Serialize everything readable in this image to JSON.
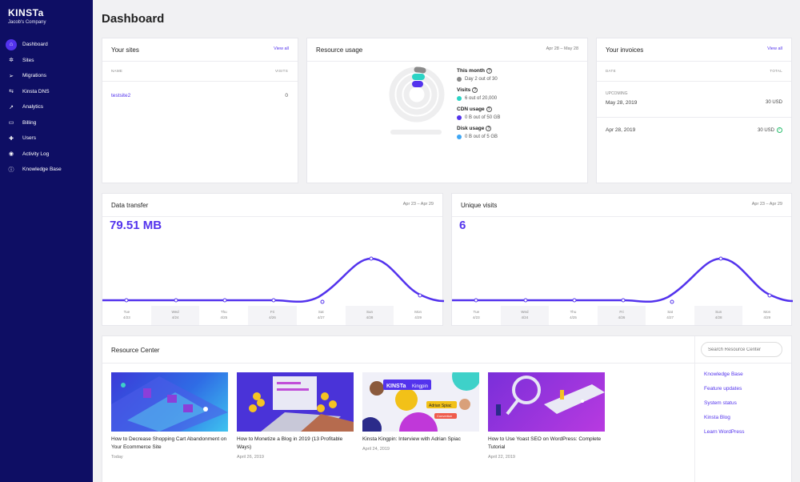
{
  "sidebar": {
    "brand": "KINSTa",
    "company": "Jacob's Company",
    "items": [
      {
        "label": "Dashboard",
        "icon": "⌂"
      },
      {
        "label": "Sites",
        "icon": "✲"
      },
      {
        "label": "Migrations",
        "icon": "➢"
      },
      {
        "label": "Kinsta DNS",
        "icon": "⇆"
      },
      {
        "label": "Analytics",
        "icon": "↗"
      },
      {
        "label": "Billing",
        "icon": "▭"
      },
      {
        "label": "Users",
        "icon": "✚"
      },
      {
        "label": "Activity Log",
        "icon": "◉"
      },
      {
        "label": "Knowledge Base",
        "icon": "ⓘ"
      }
    ]
  },
  "page_title": "Dashboard",
  "sites": {
    "title": "Your sites",
    "view_all": "View all",
    "col_name": "NAME",
    "col_visits": "VISITS",
    "rows": [
      {
        "name": "testsite2",
        "visits": "0"
      }
    ]
  },
  "resource_usage": {
    "title": "Resource usage",
    "range": "Apr 28 – May 28",
    "this_month_label": "This month",
    "this_month_value": "Day 2 out of 30",
    "visits_label": "Visits",
    "visits_value": "6 out of 20,000",
    "cdn_label": "CDN usage",
    "cdn_value": "0 B out of 50 GB",
    "disk_label": "Disk usage",
    "disk_value": "0 B out of 5 GB",
    "colors": {
      "month": "#888888",
      "visits": "#2bd4c5",
      "cdn": "#5333ed",
      "disk": "#3ea6f5"
    }
  },
  "invoices": {
    "title": "Your invoices",
    "view_all": "View all",
    "col_date": "DATE",
    "col_total": "TOTAL",
    "upcoming_label": "UPCOMING",
    "rows": [
      {
        "date": "May 28, 2019",
        "amount": "30 USD",
        "status": "upcoming"
      },
      {
        "date": "Apr 28, 2019",
        "amount": "30 USD",
        "status": "paid"
      }
    ]
  },
  "data_transfer": {
    "title": "Data transfer",
    "range": "Apr 23 – Apr 29",
    "value": "79.51 MB"
  },
  "unique_visits": {
    "title": "Unique visits",
    "range": "Apr 23 – Apr 29",
    "value": "6"
  },
  "days": [
    {
      "day": "Tue",
      "date": "4/23"
    },
    {
      "day": "Wed",
      "date": "4/24"
    },
    {
      "day": "Thu",
      "date": "4/25"
    },
    {
      "day": "Fri",
      "date": "4/26"
    },
    {
      "day": "Sat",
      "date": "4/27"
    },
    {
      "day": "Sun",
      "date": "4/28"
    },
    {
      "day": "Mon",
      "date": "4/29"
    }
  ],
  "resource_center": {
    "title": "Resource Center",
    "search_placeholder": "Search Resource Center",
    "articles": [
      {
        "title": "How to Decrease Shopping Cart Abandonment on Your Ecommerce Site",
        "date": "Today"
      },
      {
        "title": "How to Monetize a Blog in 2019 (13 Profitable Ways)",
        "date": "April 26, 2019"
      },
      {
        "title": "Kinsta Kingpin: Interview with Adrian Spiac",
        "date": "April 24, 2019"
      },
      {
        "title": "How to Use Yoast SEO on WordPress: Complete Tutorial",
        "date": "April 22, 2019"
      }
    ],
    "thumb3": {
      "brand": "KINSTa",
      "tag": "Kingpin",
      "name": "Adrian Spiac",
      "badge": "Convertize"
    },
    "links": [
      "Knowledge Base",
      "Feature updates",
      "System status",
      "Kinsta Blog",
      "Learn WordPress"
    ]
  }
}
